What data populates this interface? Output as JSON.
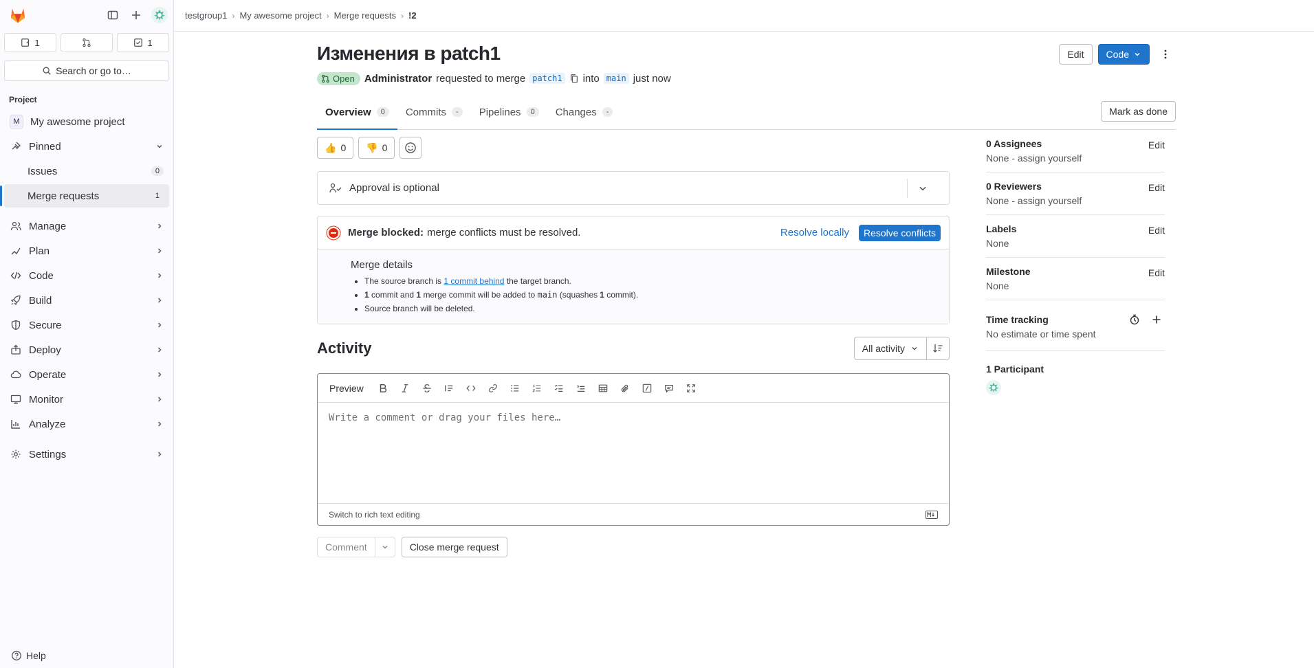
{
  "sidebar": {
    "counts": [
      {
        "icon": "issue-icon",
        "value": "1"
      },
      {
        "icon": "merge-request-icon",
        "value": ""
      },
      {
        "icon": "todo-icon",
        "value": "1"
      }
    ],
    "search_label": "Search or go to…",
    "section_label": "Project",
    "project_initial": "M",
    "project_name": "My awesome project",
    "pinned_label": "Pinned",
    "pinned_items": [
      {
        "label": "Issues",
        "count": "0"
      },
      {
        "label": "Merge requests",
        "count": "1"
      }
    ],
    "nav": [
      {
        "label": "Manage",
        "icon": "users-icon"
      },
      {
        "label": "Plan",
        "icon": "plan-icon"
      },
      {
        "label": "Code",
        "icon": "code-icon"
      },
      {
        "label": "Build",
        "icon": "rocket-icon"
      },
      {
        "label": "Secure",
        "icon": "shield-icon"
      },
      {
        "label": "Deploy",
        "icon": "deploy-icon"
      },
      {
        "label": "Operate",
        "icon": "cloud-icon"
      },
      {
        "label": "Monitor",
        "icon": "monitor-icon"
      },
      {
        "label": "Analyze",
        "icon": "chart-icon"
      }
    ],
    "settings_label": "Settings",
    "help_label": "Help"
  },
  "breadcrumb": [
    "testgroup1",
    "My awesome project",
    "Merge requests",
    "!2"
  ],
  "header": {
    "title": "Изменения в patch1",
    "edit_label": "Edit",
    "code_label": "Code",
    "status": "Open",
    "author": "Administrator",
    "action_text": "requested to merge",
    "source_branch": "patch1",
    "into_text": "into",
    "target_branch": "main",
    "time": "just now"
  },
  "tabs": [
    {
      "label": "Overview",
      "badge": "0"
    },
    {
      "label": "Commits",
      "badge": "-"
    },
    {
      "label": "Pipelines",
      "badge": "0"
    },
    {
      "label": "Changes",
      "badge": "-"
    }
  ],
  "mark_done_label": "Mark as done",
  "reactions": {
    "thumbs_up": "0",
    "thumbs_down": "0"
  },
  "approval_text": "Approval is optional",
  "merge": {
    "blocked_bold": "Merge blocked:",
    "blocked_text": "merge conflicts must be resolved.",
    "resolve_locally": "Resolve locally",
    "resolve_conflicts": "Resolve conflicts",
    "details_title": "Merge details",
    "line1_pre": "The source branch is",
    "line1_link": "1 commit behind",
    "line1_post": "the target branch.",
    "line2_a": "1",
    "line2_b": "commit and",
    "line2_c": "1",
    "line2_d": "merge commit will be added to",
    "line2_e": "main",
    "line2_f": "(squashes",
    "line2_g": "1",
    "line2_h": "commit).",
    "line3": "Source branch will be deleted."
  },
  "activity": {
    "title": "Activity",
    "filter_label": "All activity"
  },
  "editor": {
    "preview_label": "Preview",
    "placeholder": "Write a comment or drag your files here…",
    "switch_label": "Switch to rich text editing"
  },
  "comment_label": "Comment",
  "close_mr_label": "Close merge request",
  "right": {
    "assignees_title": "0 Assignees",
    "assignees_value": "None - assign yourself",
    "reviewers_title": "0 Reviewers",
    "reviewers_value": "None - assign yourself",
    "labels_title": "Labels",
    "labels_value": "None",
    "milestone_title": "Milestone",
    "milestone_value": "None",
    "time_title": "Time tracking",
    "time_value": "No estimate or time spent",
    "participants_title": "1 Participant",
    "edit_label": "Edit"
  },
  "colors": {
    "accent": "#1f75cb",
    "danger": "#dd2b0e",
    "open": "#24663b"
  }
}
